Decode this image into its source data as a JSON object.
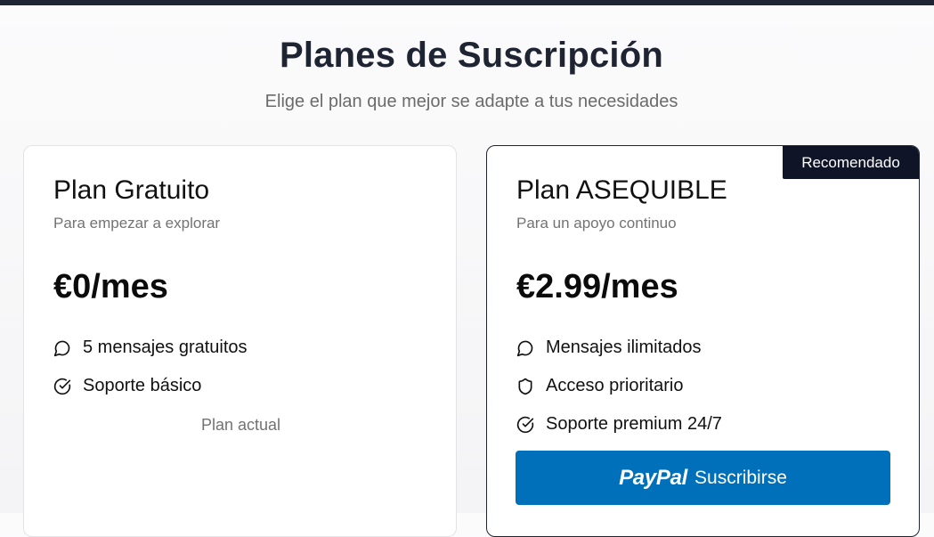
{
  "header": {
    "title": "Planes de Suscripción",
    "subtitle": "Elige el plan que mejor se adapte a tus necesidades"
  },
  "plans": [
    {
      "name": "Plan Gratuito",
      "description": "Para empezar a explorar",
      "price": "€0/mes",
      "features": [
        {
          "icon": "message-circle-icon",
          "label": "5 mensajes gratuitos"
        },
        {
          "icon": "check-circle-icon",
          "label": "Soporte básico"
        }
      ],
      "status_label": "Plan actual"
    },
    {
      "badge": "Recomendado",
      "name": "Plan ASEQUIBLE",
      "description": "Para un apoyo continuo",
      "price": "€2.99/mes",
      "features": [
        {
          "icon": "message-circle-icon",
          "label": "Mensajes ilimitados"
        },
        {
          "icon": "shield-icon",
          "label": "Acceso prioritario"
        },
        {
          "icon": "check-circle-icon",
          "label": "Soporte premium 24/7"
        }
      ],
      "button": {
        "logo_text": "PayPal",
        "label": "Suscribirse"
      }
    }
  ],
  "colors": {
    "accent_dark": "#0f1526",
    "paypal_blue": "#0070ba",
    "muted_text": "#737373"
  }
}
